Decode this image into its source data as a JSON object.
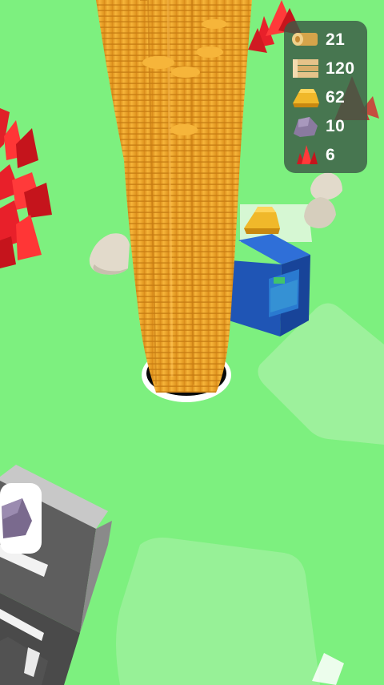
{
  "resources": [
    {
      "name": "logs",
      "icon": "log-icon",
      "value": "21"
    },
    {
      "name": "planks",
      "icon": "planks-icon",
      "value": "120"
    },
    {
      "name": "gold",
      "icon": "gold-bar-icon",
      "value": "62"
    },
    {
      "name": "stone",
      "icon": "stone-icon",
      "value": "10"
    },
    {
      "name": "crystal",
      "icon": "crystal-icon",
      "value": "6"
    }
  ],
  "colors": {
    "ground": "#7df07f",
    "coin": "#f2a72a",
    "crystal": "#e8202a",
    "machine": "#1f55b5",
    "hud_bg": "#3c5a46"
  }
}
